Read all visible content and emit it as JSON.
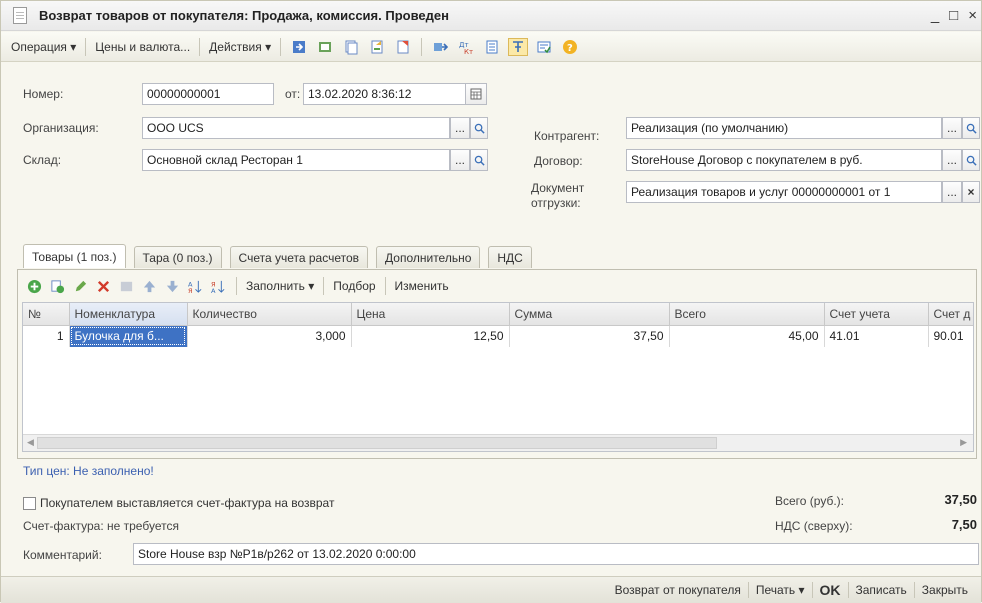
{
  "window": {
    "title": "Возврат товаров от покупателя: Продажа, комиссия. Проведен",
    "controls": [
      "_",
      "□",
      "×"
    ]
  },
  "toolbar": {
    "operation": "Операция ▾",
    "prices": "Цены и валюта...",
    "actions": "Действия ▾"
  },
  "header": {
    "number_label": "Номер:",
    "number_value": "00000000001",
    "date_label": "от:",
    "date_value": "13.02.2020  8:36:12",
    "org_label": "Организация:",
    "org_value": "ООО UCS",
    "warehouse_label": "Склад:",
    "warehouse_value": "Основной склад Ресторан 1",
    "counterparty_label": "Контрагент:",
    "counterparty_value": "Реализация (по умолчанию)",
    "contract_label": "Договор:",
    "contract_value": "StoreHouse Договор с покупателем в руб.",
    "shipment_label_1": "Документ",
    "shipment_label_2": "отгрузки:",
    "shipment_value": "Реализация товаров и услуг 00000000001 от 1",
    "ellipsis": "...",
    "clear": "×"
  },
  "tabs": [
    {
      "label": "Товары (1 поз.)"
    },
    {
      "label": "Тара (0 поз.)"
    },
    {
      "label": "Счета учета расчетов"
    },
    {
      "label": "Дополнительно"
    },
    {
      "label": "НДС"
    }
  ],
  "panel_toolbar": {
    "fill": "Заполнить ▾",
    "pick": "Подбор",
    "edit": "Изменить"
  },
  "table": {
    "columns": [
      "№",
      "Номенклатура",
      "Количество",
      "Цена",
      "Сумма",
      "Всего",
      "Счет учета",
      "Счет д"
    ],
    "rows": [
      [
        "1",
        "Булочка для б...",
        "3,000",
        "12,50",
        "37,50",
        "45,00",
        "41.01",
        "90.01"
      ]
    ]
  },
  "footer": {
    "price_type": "Тип цен: Не заполнено!",
    "invoice_check": "Покупателем выставляется счет-фактура на возврат",
    "invoice_status": "Счет-фактура:  не требуется",
    "total_label": "Всего (руб.):",
    "total_value": "37,50",
    "vat_label": "НДС (сверху):",
    "vat_value": "7,50",
    "comment_label": "Комментарий:",
    "comment_value": "Store House взр №Р1в/р262 от 13.02.2020 0:00:00"
  },
  "statusbar": {
    "return": "Возврат от покупателя",
    "print": "Печать ▾",
    "ok": "OK",
    "save": "Записать",
    "close": "Закрыть"
  }
}
